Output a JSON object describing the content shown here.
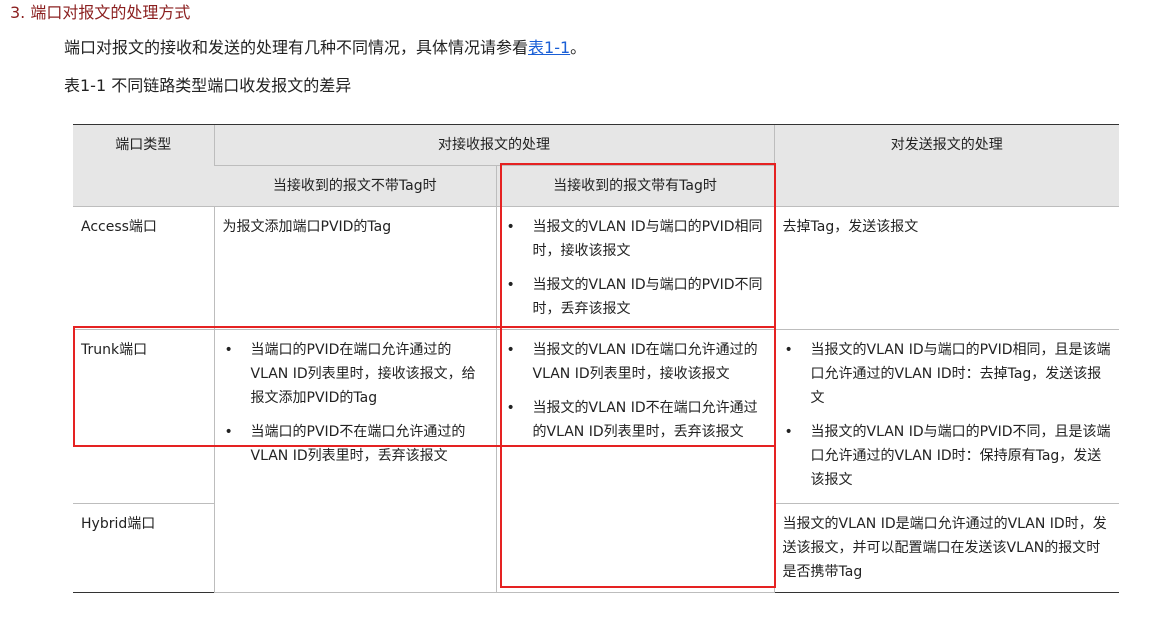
{
  "section_heading": "3. 端口对报文的处理方式",
  "intro": {
    "text_before": "端口对报文的接收和发送的处理有几种不同情况，具体情况请参看",
    "link": "表1-1",
    "text_after": "。"
  },
  "table_caption": "表1-1 不同链路类型端口收发报文的差异",
  "table": {
    "headers": {
      "port_type": "端口类型",
      "receive": "对接收报文的处理",
      "receive_untagged": "当接收到的报文不带Tag时",
      "receive_tagged": "当接收到的报文带有Tag时",
      "send": "对发送报文的处理"
    },
    "rows": [
      {
        "port": "Access端口",
        "untagged": "为报文添加端口PVID的Tag",
        "tagged": [
          "当报文的VLAN ID与端口的PVID相同时，接收该报文",
          "当报文的VLAN ID与端口的PVID不同时，丢弃该报文"
        ],
        "send": "去掉Tag，发送该报文"
      },
      {
        "port": "Trunk端口",
        "untagged": [
          "当端口的PVID在端口允许通过的VLAN ID列表里时，接收该报文，给报文添加PVID的Tag",
          "当端口的PVID不在端口允许通过的VLAN ID列表里时，丢弃该报文"
        ],
        "tagged": [
          "当报文的VLAN ID在端口允许通过的VLAN ID列表里时，接收该报文",
          "当报文的VLAN ID不在端口允许通过的VLAN ID列表里时，丢弃该报文"
        ],
        "send": [
          "当报文的VLAN ID与端口的PVID相同，且是该端口允许通过的VLAN ID时：去掉Tag，发送该报文",
          "当报文的VLAN ID与端口的PVID不同，且是该端口允许通过的VLAN ID时：保持原有Tag，发送该报文"
        ]
      },
      {
        "port": "Hybrid端口",
        "send": "当报文的VLAN ID是端口允许通过的VLAN ID时，发送该报文，并可以配置端口在发送该VLAN的报文时是否携带Tag"
      }
    ]
  },
  "annotation_color": "#e52222"
}
